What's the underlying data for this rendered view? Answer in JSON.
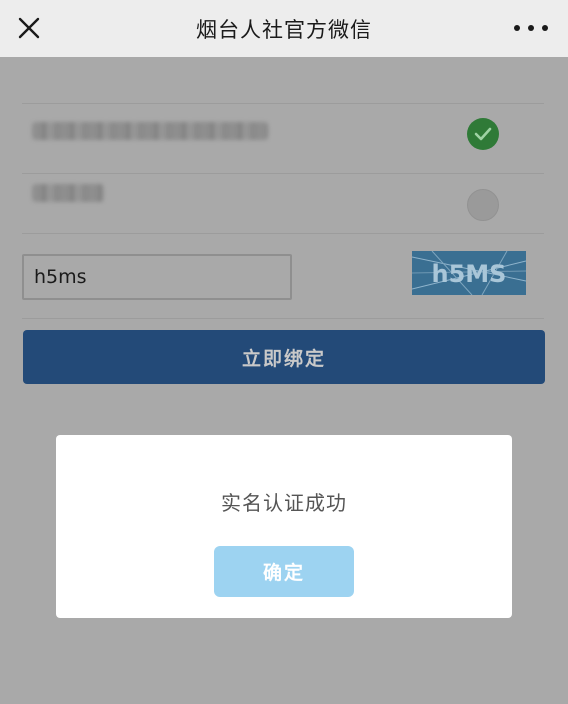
{
  "navbar": {
    "title": "烟台人社官方微信",
    "close_icon": "close-icon",
    "more_icon": "more-icon"
  },
  "form": {
    "captcha_value": "h5ms",
    "captcha_image_text": "h5MS",
    "bind_button_label": "立即绑定",
    "verified_icon": "check-circle-icon"
  },
  "modal": {
    "message": "实名认证成功",
    "confirm_label": "确定"
  },
  "colors": {
    "primary": "#234a78",
    "confirm": "#9dd3f1",
    "success": "#2f7a37"
  }
}
